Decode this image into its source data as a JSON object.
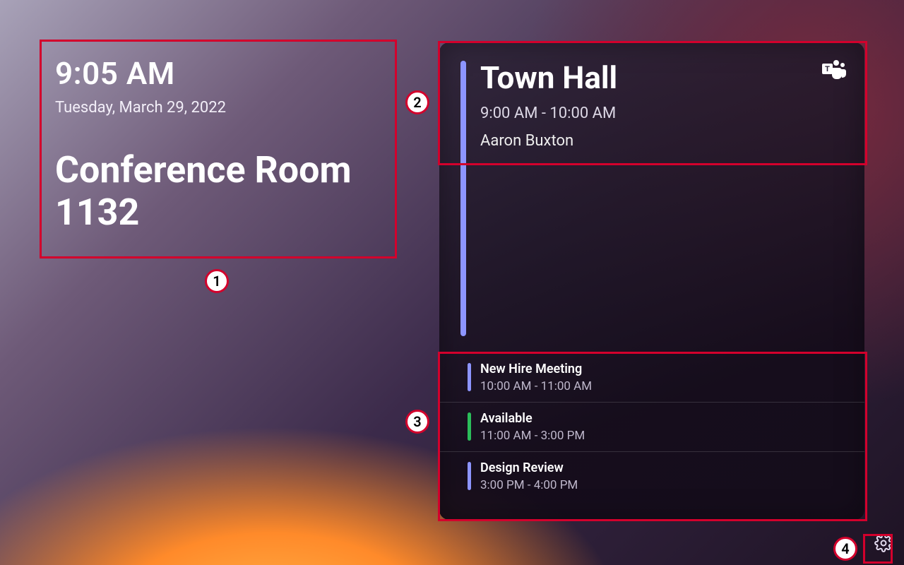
{
  "colors": {
    "annotation": "#d3002c",
    "busy_bar": "#8d95ff",
    "available_bar": "#2bbd5a"
  },
  "callouts": [
    "1",
    "2",
    "3",
    "4"
  ],
  "left": {
    "time": "9:05 AM",
    "date": "Tuesday, March 29, 2022",
    "room": "Conference Room 1132"
  },
  "current": {
    "title": "Town Hall",
    "time_range": "9:00 AM - 10:00 AM",
    "organizer": "Aaron Buxton",
    "platform_icon": "teams-icon"
  },
  "upcoming": [
    {
      "title": "New Hire Meeting",
      "time_range": "10:00 AM - 11:00 AM",
      "status": "busy"
    },
    {
      "title": "Available",
      "time_range": "11:00 AM - 3:00 PM",
      "status": "available"
    },
    {
      "title": "Design Review",
      "time_range": "3:00 PM - 4:00 PM",
      "status": "busy"
    }
  ]
}
